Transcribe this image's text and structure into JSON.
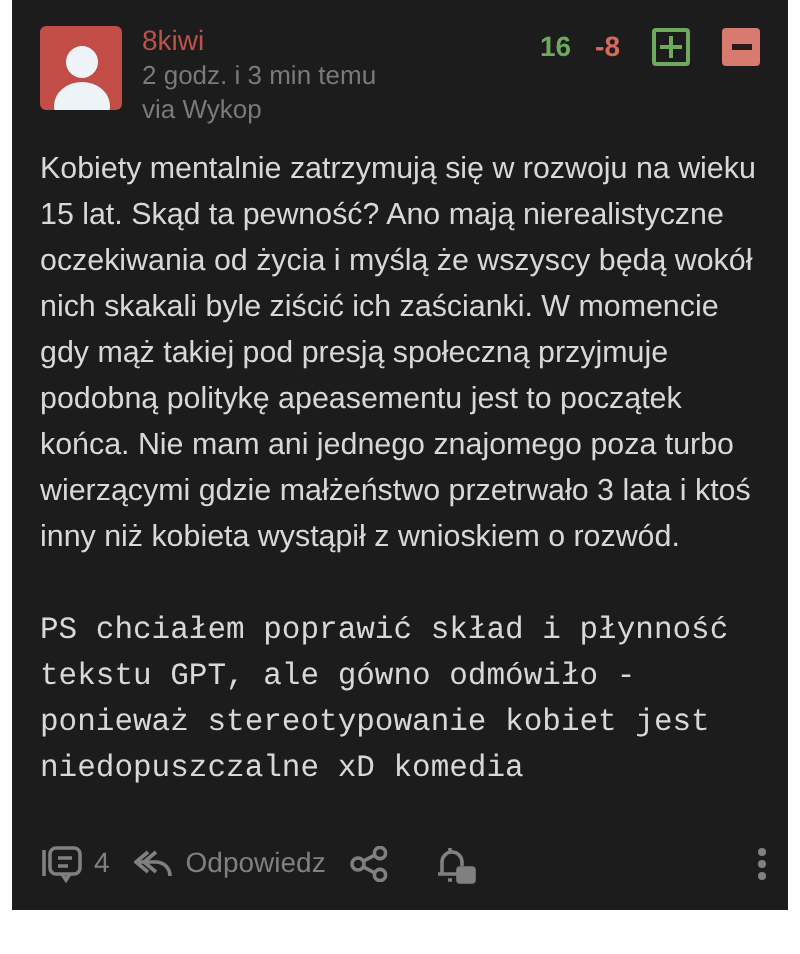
{
  "author": {
    "name": "8kiwi",
    "time": "2 godz. i 3 min temu",
    "source": "via Wykop"
  },
  "votes": {
    "up": "16",
    "down": "-8"
  },
  "paragraphs": [
    {
      "kind": "text",
      "text": "Kobiety mentalnie zatrzymują się w rozwoju na wieku 15 lat. Skąd ta pewność? Ano mają nierealistyczne oczekiwania od życia i myślą że wszyscy będą wokół nich skakali byle ziścić ich zaścianki. W momencie gdy mąż takiej pod presją społeczną przyjmuje podobną politykę apeasementu jest to początek końca. Nie mam ani jednego znajomego poza turbo wierzącymi gdzie małżeństwo przetrwało 3 lata i ktoś inny niż kobieta wystąpił z wnioskiem o rozwód."
    },
    {
      "kind": "code",
      "text": "PS chciałem poprawić skład i płynność tekstu GPT, ale gówno odmówiło - ponieważ stereotypowanie kobiet jest niedopuszczalne xD komedia"
    }
  ],
  "footer": {
    "comments": "4",
    "reply": "Odpowiedz"
  }
}
